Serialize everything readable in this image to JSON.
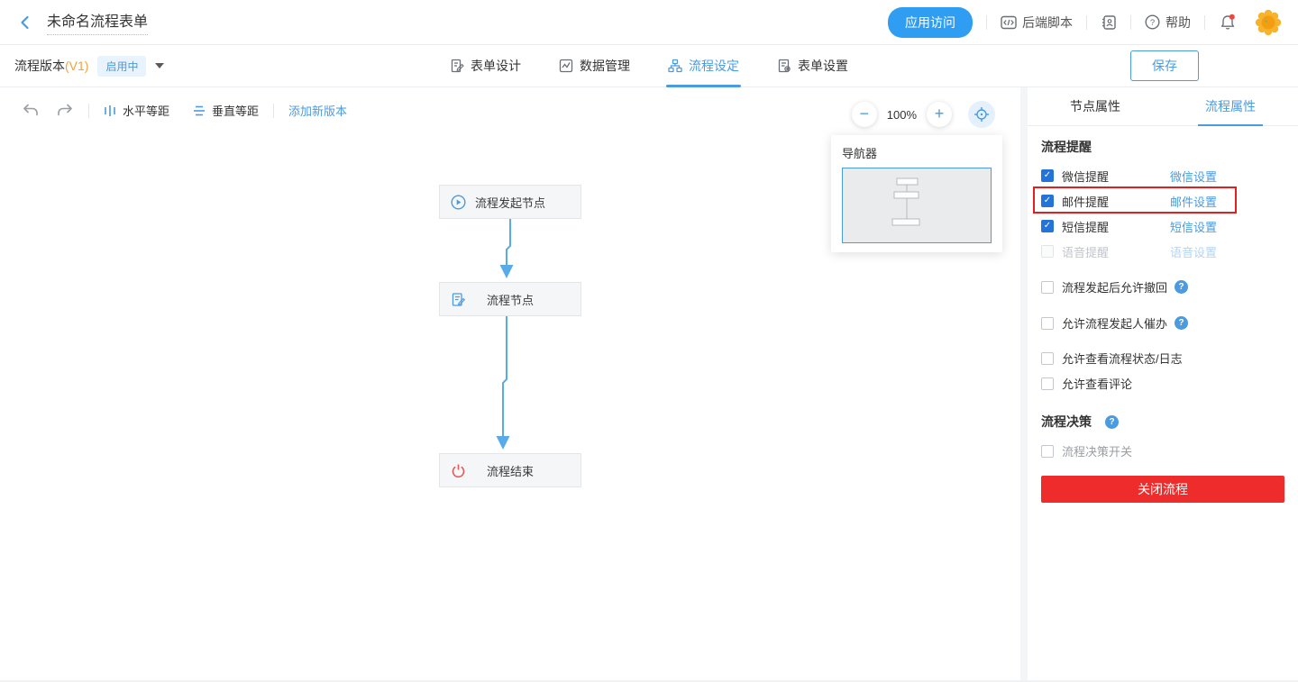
{
  "header": {
    "title": "未命名流程表单",
    "app_access_label": "应用访问",
    "backend_script_label": "后端脚本",
    "help_label": "帮助"
  },
  "subheader": {
    "version_label": "流程版本",
    "version_tag": "(V1)",
    "status_badge": "启用中",
    "tabs": [
      {
        "label": "表单设计",
        "active": false
      },
      {
        "label": "数据管理",
        "active": false
      },
      {
        "label": "流程设定",
        "active": true
      },
      {
        "label": "表单设置",
        "active": false
      }
    ],
    "save_label": "保存"
  },
  "canvas": {
    "toolbar": {
      "horizontal_distribute_label": "水平等距",
      "vertical_distribute_label": "垂直等距",
      "add_version_label": "添加新版本",
      "zoom_level": "100%"
    },
    "nodes": [
      {
        "label": "流程发起节点",
        "icon": "play-icon"
      },
      {
        "label": "流程节点",
        "icon": "form-icon"
      },
      {
        "label": "流程结束",
        "icon": "power-icon"
      }
    ],
    "navigator": {
      "title": "导航器"
    }
  },
  "panel": {
    "tabs": [
      {
        "label": "节点属性",
        "active": false
      },
      {
        "label": "流程属性",
        "active": true
      }
    ],
    "reminder_section_title": "流程提醒",
    "reminders": [
      {
        "label": "微信提醒",
        "link": "微信设置",
        "checked": true,
        "disabled": false,
        "highlighted": false
      },
      {
        "label": "邮件提醒",
        "link": "邮件设置",
        "checked": true,
        "disabled": false,
        "highlighted": true
      },
      {
        "label": "短信提醒",
        "link": "短信设置",
        "checked": true,
        "disabled": false,
        "highlighted": false
      },
      {
        "label": "语音提醒",
        "link": "语音设置",
        "checked": false,
        "disabled": true,
        "highlighted": false
      }
    ],
    "options": [
      {
        "label": "流程发起后允许撤回",
        "help": true,
        "checked": false
      },
      {
        "label": "允许流程发起人催办",
        "help": true,
        "checked": false
      },
      {
        "label": "允许查看流程状态/日志",
        "help": false,
        "checked": false
      },
      {
        "label": "允许查看评论",
        "help": false,
        "checked": false
      }
    ],
    "decision_section_title": "流程决策",
    "decision_option_label": "流程决策开关",
    "close_button_label": "关闭流程"
  },
  "icons": {
    "back": "chevron-left",
    "code": "angle-brackets",
    "contacts": "address-book",
    "help": "question-circle",
    "bell": "notification-bell-with-red-dot",
    "avatar": "orange-flower-sticker",
    "undo": "curved-arrow-left",
    "redo": "curved-arrow-right",
    "zoom_out": "minus-circle",
    "zoom_in": "plus-circle",
    "locate": "crosshair-target"
  },
  "colors": {
    "accent_blue": "#4a9be0",
    "primary_pill_blue": "#2f9df2",
    "checkbox_blue": "#2373d8",
    "connector_blue": "#57abe9",
    "danger_red": "#ee2c2c",
    "highlight_red": "#e31e1e",
    "version_orange": "#f5a03c"
  }
}
